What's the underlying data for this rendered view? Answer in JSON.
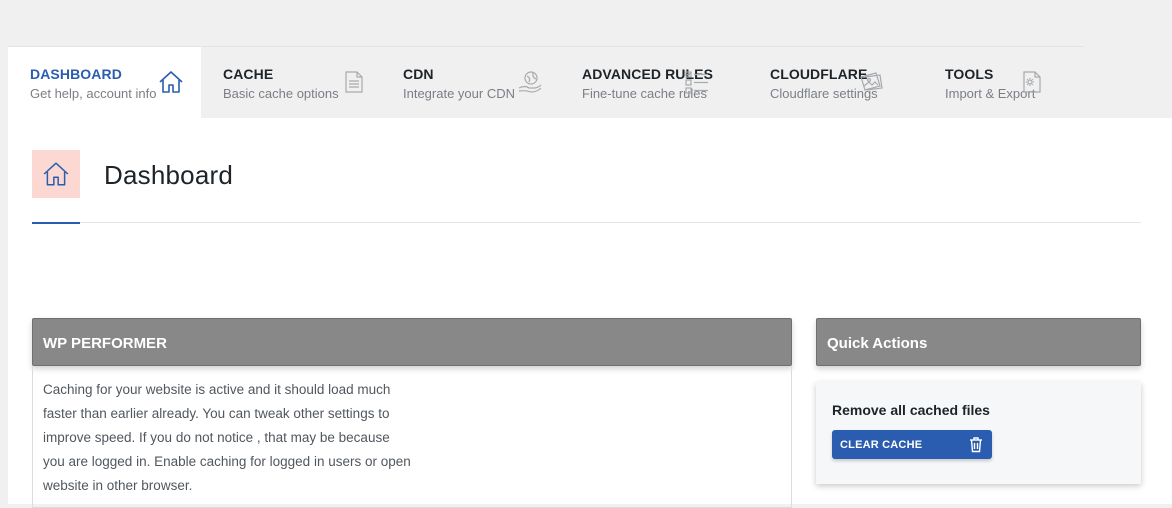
{
  "tabs": [
    {
      "title": "DASHBOARD",
      "desc": "Get help, account info",
      "icon": "home-icon",
      "active": true
    },
    {
      "title": "CACHE",
      "desc": "Basic cache options",
      "icon": "document-icon",
      "active": false
    },
    {
      "title": "CDN",
      "desc": "Integrate your CDN",
      "icon": "globe-hand-icon",
      "active": false
    },
    {
      "title": "ADVANCED RULES",
      "desc": "Fine-tune cache rules",
      "icon": "checklist-icon",
      "active": false
    },
    {
      "title": "CLOUDFLARE",
      "desc": "Cloudflare settings",
      "icon": "images-icon",
      "active": false
    },
    {
      "title": "TOOLS",
      "desc": "Import & Export",
      "icon": "file-gear-icon",
      "active": false
    }
  ],
  "page": {
    "title": "Dashboard",
    "icon": "home-icon"
  },
  "wp_card": {
    "title": "WP PERFORMER",
    "body": "Caching for your website is active and it should load much faster than earlier already. You can tweak other settings to improve speed. If you do not notice , that may be because you are logged in. Enable caching for logged in users or open website in other browser."
  },
  "quick_actions": {
    "title": "Quick Actions",
    "label": "Remove all cached files",
    "button_label": "CLEAR CACHE",
    "button_icon": "trash-icon"
  },
  "colors": {
    "accent": "#2a5db0",
    "card_header": "#888888",
    "page_icon_bg": "#fbd9d2"
  }
}
